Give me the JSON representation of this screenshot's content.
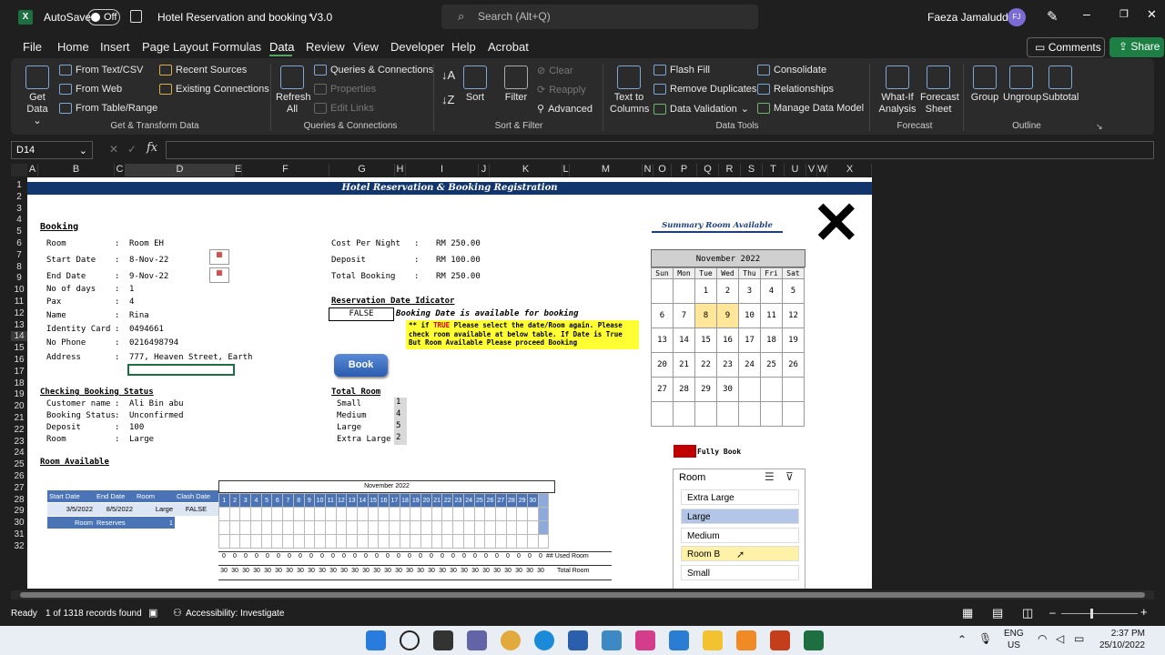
{
  "titlebar": {
    "autosave_label": "AutoSave",
    "autosave_state": "Off",
    "doc_title": "Hotel Reservation and booking V3.0",
    "search_placeholder": "Search (Alt+Q)",
    "user_name": "Faeza Jamaluddin",
    "user_initials": "FJ"
  },
  "menu": {
    "items": [
      "File",
      "Home",
      "Insert",
      "Page Layout",
      "Formulas",
      "Data",
      "Review",
      "View",
      "Developer",
      "Help",
      "Acrobat"
    ],
    "active": "Data",
    "comments": "Comments",
    "share": "Share"
  },
  "ribbon": {
    "get_data": "Get Data",
    "from_text": "From Text/CSV",
    "from_web": "From Web",
    "from_table": "From Table/Range",
    "recent_sources": "Recent Sources",
    "existing_connections": "Existing Connections",
    "group_get": "Get & Transform Data",
    "refresh_all": "Refresh All",
    "queries": "Queries & Connections",
    "properties": "Properties",
    "edit_links": "Edit Links",
    "group_queries": "Queries & Connections",
    "sort": "Sort",
    "filter": "Filter",
    "clear": "Clear",
    "reapply": "Reapply",
    "advanced": "Advanced",
    "group_sort": "Sort & Filter",
    "text_to_columns": "Text to Columns",
    "flash_fill": "Flash Fill",
    "remove_duplicates": "Remove Duplicates",
    "data_validation": "Data Validation",
    "consolidate": "Consolidate",
    "relationships": "Relationships",
    "manage_model": "Manage Data Model",
    "group_tools": "Data Tools",
    "what_if": "What-If Analysis",
    "forecast_sheet": "Forecast Sheet",
    "group_forecast": "Forecast",
    "group_btn": "Group",
    "ungroup": "Ungroup",
    "subtotal": "Subtotal",
    "group_outline": "Outline"
  },
  "formula_bar": {
    "name_box": "D14",
    "formula": ""
  },
  "columns": [
    "A",
    "B",
    "C",
    "D",
    "E",
    "F",
    "G",
    "H",
    "I",
    "J",
    "K",
    "L",
    "M",
    "N",
    "O",
    "P",
    "Q",
    "R",
    "S",
    "T",
    "U",
    "V",
    "W",
    "X"
  ],
  "rows": [
    "1",
    "2",
    "3",
    "4",
    "5",
    "6",
    "7",
    "8",
    "9",
    "10",
    "11",
    "12",
    "13",
    "14",
    "15",
    "16",
    "17",
    "18",
    "19",
    "20",
    "21",
    "22",
    "23",
    "24",
    "25",
    "26",
    "27",
    "28",
    "29",
    "30",
    "31",
    "32"
  ],
  "sheet": {
    "banner": "Hotel Reservation & Booking Registration",
    "booking_heading": "Booking",
    "booking_fields": [
      {
        "label": "Room",
        "value": "Room EH"
      },
      {
        "label": "Start Date",
        "value": "8-Nov-22"
      },
      {
        "label": "End Date",
        "value": "9-Nov-22"
      },
      {
        "label": "No of days",
        "value": "1"
      },
      {
        "label": "Pax",
        "value": "4"
      },
      {
        "label": "Name",
        "value": "Rina"
      },
      {
        "label": "Identity Card",
        "value": "0494661"
      },
      {
        "label": "No Phone",
        "value": "0216498794"
      },
      {
        "label": "Address",
        "value": "777, Heaven Street, Earth"
      }
    ],
    "costs": [
      {
        "label": "Cost Per Night",
        "value": "RM 250.00"
      },
      {
        "label": "Deposit",
        "value": "RM 100.00"
      },
      {
        "label": "Total Booking",
        "value": "RM 250.00"
      }
    ],
    "indicator_heading": "Reservation Date Idicator",
    "indicator_value": "FALSE",
    "indicator_msg": "Booking Date is available for booking",
    "note_prefix": "** if ",
    "note_true": "TRUE",
    "note_text": " Please select the date/Room again. Please check room available at below table. If Date is True But Room Available Please proceed Booking",
    "book_button": "Book",
    "status_heading": "Checking Booking Status",
    "status_fields": [
      {
        "label": "Customer name",
        "value": "Ali Bin abu"
      },
      {
        "label": "Booking Status",
        "value": "Unconfirmed"
      },
      {
        "label": "Deposit",
        "value": "100"
      },
      {
        "label": "Room",
        "value": "Large"
      }
    ],
    "total_room_heading": "Total Room",
    "total_rooms": [
      {
        "label": "Small",
        "value": "1"
      },
      {
        "label": "Medium",
        "value": "4"
      },
      {
        "label": "Large",
        "value": "5"
      },
      {
        "label": "Extra Large",
        "value": "2"
      }
    ],
    "room_available_heading": "Room Available",
    "avail_table": {
      "headers": [
        "Start Date",
        "End Date",
        "Room",
        "Clash Date"
      ],
      "row": [
        "3/5/2022",
        "8/5/2022",
        "Large",
        "FALSE"
      ],
      "footer": [
        "Room",
        "Reserves",
        "1"
      ]
    },
    "mini_month": "November 2022",
    "mini_days": [
      "1",
      "2",
      "3",
      "4",
      "5",
      "6",
      "7",
      "8",
      "9",
      "10",
      "11",
      "12",
      "13",
      "14",
      "15",
      "16",
      "17",
      "18",
      "19",
      "20",
      "21",
      "22",
      "23",
      "24",
      "25",
      "26",
      "27",
      "28",
      "29",
      "30"
    ],
    "used_label": "## Used Room",
    "total_label": "Total Room",
    "used_value": "0",
    "total_value": "30",
    "summary_title": "Summary Room Available",
    "cal_month": "November 2022",
    "cal_days": [
      "Sun",
      "Mon",
      "Tue",
      "Wed",
      "Thu",
      "Fri",
      "Sat"
    ],
    "cal_weeks": [
      [
        "",
        "",
        "1",
        "2",
        "3",
        "4",
        "5"
      ],
      [
        "6",
        "7",
        "8",
        "9",
        "10",
        "11",
        "12"
      ],
      [
        "13",
        "14",
        "15",
        "16",
        "17",
        "18",
        "19"
      ],
      [
        "20",
        "21",
        "22",
        "23",
        "24",
        "25",
        "26"
      ],
      [
        "27",
        "28",
        "29",
        "30",
        "",
        "",
        ""
      ],
      [
        "",
        "",
        "",
        "",
        "",
        "",
        ""
      ]
    ],
    "legend_full": "Fully Book",
    "slicer_title": "Room",
    "slicer_items": [
      "Extra Large",
      "Large",
      "Medium",
      "Room B",
      "Small"
    ]
  },
  "status": {
    "ready": "Ready",
    "records": "1 of 1318 records found",
    "accessibility": "Accessibility: Investigate"
  },
  "taskbar": {
    "lang": "ENG",
    "region": "US",
    "time": "2:37 PM",
    "date": "25/10/2022"
  }
}
